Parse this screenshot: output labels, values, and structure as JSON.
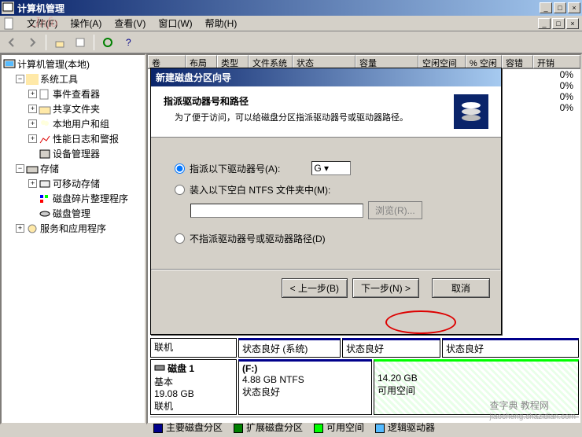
{
  "window": {
    "title": "计算机管理",
    "min": "_",
    "max": "□",
    "close": "×"
  },
  "menu": {
    "file": "文件(F)",
    "action": "操作(A)",
    "view": "查看(V)",
    "window": "窗口(W)",
    "help": "帮助(H)"
  },
  "tree": {
    "root": "计算机管理(本地)",
    "systools": "系统工具",
    "eventviewer": "事件查看器",
    "shared": "共享文件夹",
    "users": "本地用户和组",
    "perflogs": "性能日志和警报",
    "devmgr": "设备管理器",
    "storage": "存储",
    "removable": "可移动存储",
    "defrag": "磁盘碎片整理程序",
    "diskmgmt": "磁盘管理",
    "services": "服务和应用程序"
  },
  "columns": {
    "volume": "卷",
    "layout": "布局",
    "type": "类型",
    "fs": "文件系统",
    "status": "状态",
    "capacity": "容量",
    "free": "空闲空间",
    "pct_free": "% 空闲",
    "fault": "容错",
    "overhead": "开销"
  },
  "pct_rows": [
    "0%",
    "0%",
    "0%",
    "0%"
  ],
  "wizard": {
    "title": "新建磁盘分区向导",
    "heading": "指派驱动器号和路径",
    "subheading": "为了便于访问，可以给磁盘分区指派驱动器号或驱动器路径。",
    "opt_assign": "指派以下驱动器号(A):",
    "drive_letter": "G",
    "opt_mount": "装入以下空白 NTFS 文件夹中(M):",
    "browse": "浏览(R)...",
    "opt_none": "不指派驱动器号或驱动器路径(D)",
    "back": "< 上一步(B)",
    "next": "下一步(N) >",
    "cancel": "取消"
  },
  "disks": {
    "online": "联机",
    "sys_status": "状态良好 (系统)",
    "good": "状态良好",
    "disk1_label": "磁盘 1",
    "disk1_type": "基本",
    "disk1_size": "19.08 GB",
    "part_f_label": "(F:)",
    "part_f_info": "4.88 GB NTFS",
    "part_f_status": "状态良好",
    "free_size": "14.20 GB",
    "free_label": "可用空间"
  },
  "legend": {
    "primary": "主要磁盘分区",
    "extended": "扩展磁盘分区",
    "free": "可用空间",
    "logical": "逻辑驱动器"
  },
  "watermark": {
    "main": "查字典 教程网",
    "sub": "jiaocheng.chazidian.com",
    "overlay": ".Info"
  }
}
